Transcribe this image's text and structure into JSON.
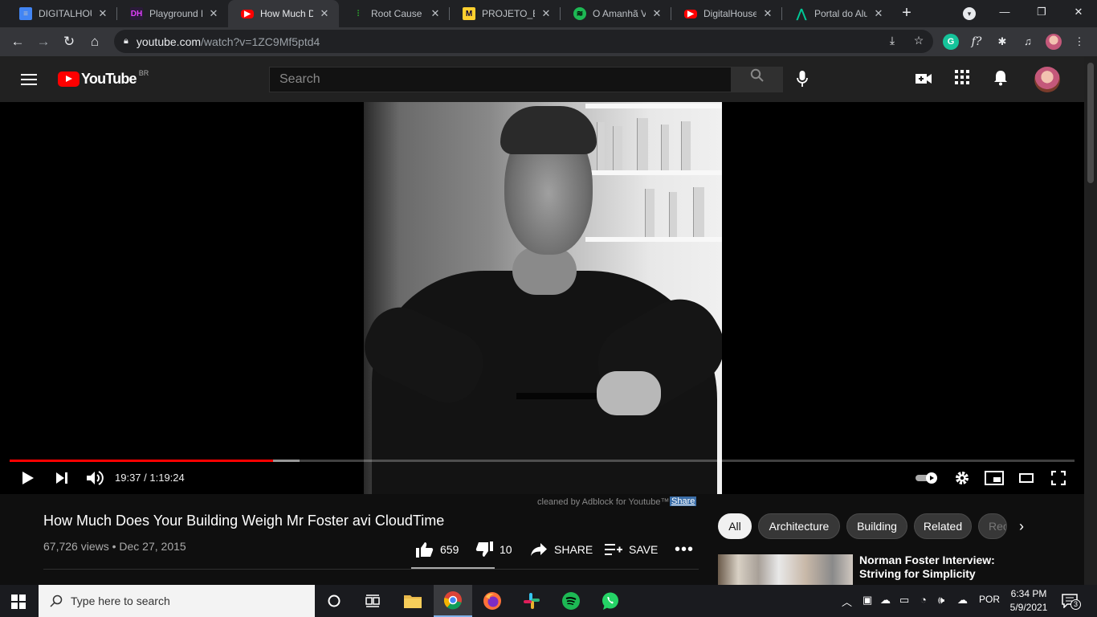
{
  "browser": {
    "tabs": [
      {
        "title": "DIGITALHOUSE",
        "favicon": "docs-icon",
        "color": "#4285f4",
        "active": false
      },
      {
        "title": "Playground DH",
        "favicon": "dh-icon",
        "color": "#b33ac4",
        "active": false
      },
      {
        "title": "How Much Does",
        "favicon": "youtube-icon",
        "color": "#ff0000",
        "active": true
      },
      {
        "title": "Root Cause Analysis",
        "favicon": "chart-icon",
        "color": "#2eb82e",
        "active": false
      },
      {
        "title": "PROJETO_EXP",
        "favicon": "miro-icon",
        "color": "#ffd02f",
        "active": false
      },
      {
        "title": "O Amanhã Va",
        "favicon": "spotify-icon",
        "color": "#1db954",
        "active": false
      },
      {
        "title": "DigitalHouse",
        "favicon": "youtube-icon",
        "color": "#ff0000",
        "active": false
      },
      {
        "title": "Portal do Aluno",
        "favicon": "portal-icon",
        "color": "#00c896",
        "active": false
      }
    ],
    "url_domain": "youtube.com",
    "url_path": "/watch?v=1ZC9Mf5ptd4"
  },
  "youtube": {
    "logo_text": "YouTube",
    "region": "BR",
    "search_placeholder": "Search"
  },
  "player": {
    "current_time": "19:37",
    "duration": "1:19:24",
    "time_display": "19:37 / 1:19:24",
    "progress_fraction": 0.247,
    "buffered_fraction": 0.272
  },
  "video": {
    "adblock_note": "cleaned by Adblock for Youtube™",
    "adblock_share": "Share",
    "title": "How Much Does Your Building Weigh Mr Foster avi CloudTime",
    "meta": "67,726 views • Dec 27, 2015",
    "likes": "659",
    "dislikes": "10",
    "share_label": "SHARE",
    "save_label": "SAVE"
  },
  "chips": [
    "All",
    "Architecture",
    "Building",
    "Related",
    "Recently uploaded"
  ],
  "recommendation": {
    "title": "Norman Foster Interview: Striving for Simplicity"
  },
  "taskbar": {
    "search_placeholder": "Type here to search",
    "language": "POR",
    "time": "6:34 PM",
    "date": "5/9/2021",
    "notifications": "3"
  }
}
